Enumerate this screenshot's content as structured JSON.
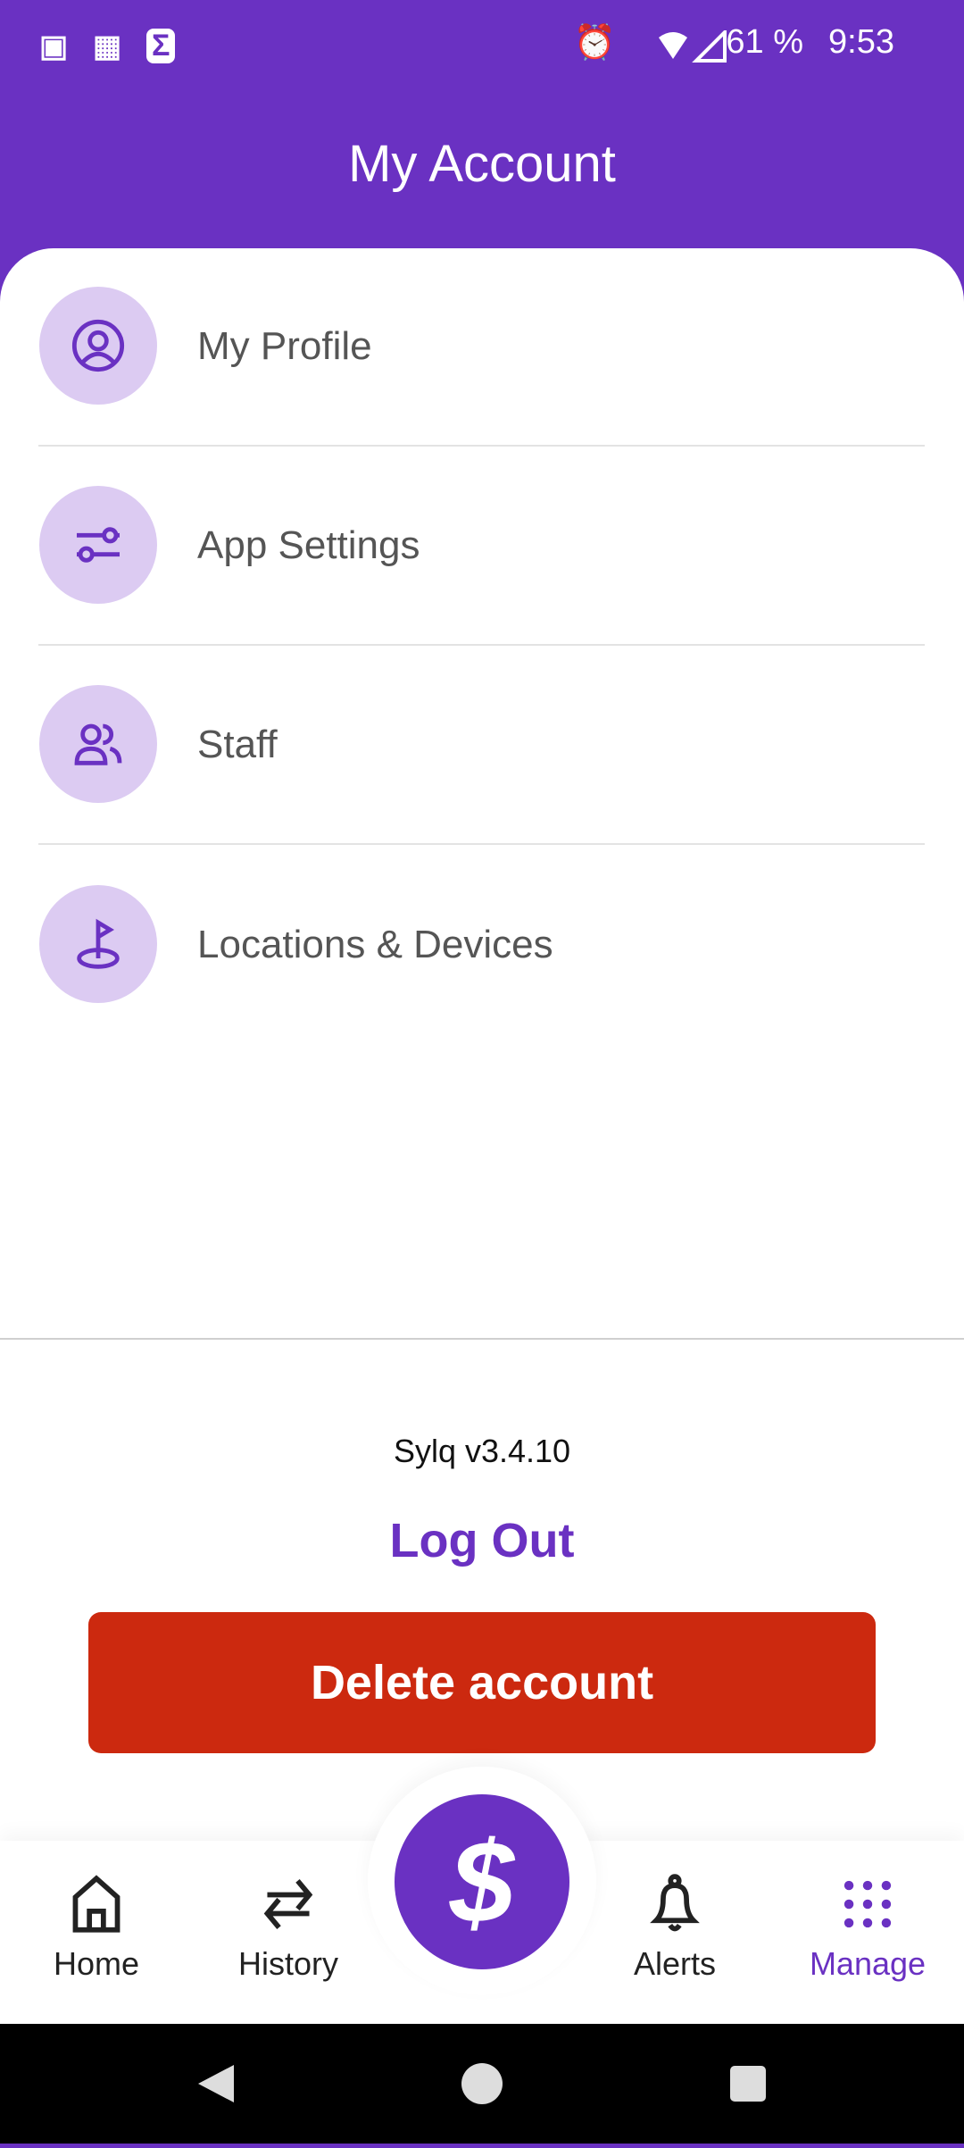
{
  "status_bar": {
    "battery": "61 %",
    "time": "9:53",
    "left_icons": [
      "outlook-icon",
      "outlook-calendar-icon",
      "sigma-app-icon"
    ],
    "right_icons": [
      "alarm-icon",
      "wifi-icon",
      "signal-icon"
    ]
  },
  "header": {
    "title": "My Account"
  },
  "menu": [
    {
      "label": "My Profile",
      "icon": "user-circle-icon"
    },
    {
      "label": "App Settings",
      "icon": "sliders-icon"
    },
    {
      "label": "Staff",
      "icon": "users-icon"
    },
    {
      "label": "Locations & Devices",
      "icon": "location-flag-icon"
    }
  ],
  "footer": {
    "version": "Sylq v3.4.10",
    "logout": "Log Out",
    "delete": "Delete account"
  },
  "nav": {
    "items": [
      {
        "label": "Home",
        "icon": "home-icon"
      },
      {
        "label": "History",
        "icon": "arrows-swap-icon"
      },
      {
        "label": "Alerts",
        "icon": "bell-icon"
      },
      {
        "label": "Manage",
        "icon": "grid-dots-icon",
        "active": true
      }
    ],
    "fab_icon": "dollar-icon",
    "fab_symbol": "$"
  },
  "colors": {
    "brand": "#6a31c2",
    "danger": "#cc290f",
    "icon_bg": "#dccbf2"
  }
}
